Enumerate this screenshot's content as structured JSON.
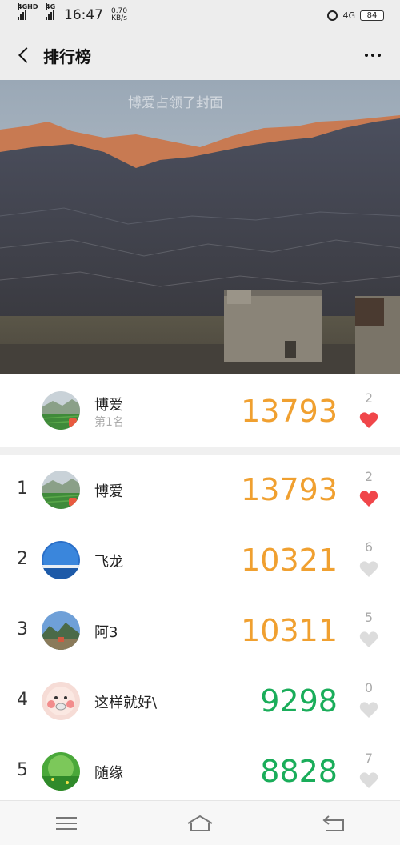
{
  "status_bar": {
    "signal1": "4GHD",
    "signal2": "4G",
    "time": "16:47",
    "speed_value": "0.70",
    "speed_unit": "KB/s",
    "net_right": "4G",
    "battery": "84"
  },
  "nav": {
    "title": "排行榜"
  },
  "cover": {
    "watermark": "博爱占领了封面"
  },
  "my_entry": {
    "name": "博爱",
    "rank_label": "第1名",
    "steps": "13793",
    "likes": "2",
    "liked": true
  },
  "ranking": [
    {
      "rank": "1",
      "name": "博爱",
      "steps": "13793",
      "likes": "2",
      "liked": true,
      "color": "#f0a030"
    },
    {
      "rank": "2",
      "name": "飞龙",
      "steps": "10321",
      "likes": "6",
      "liked": false,
      "color": "#f0a030"
    },
    {
      "rank": "3",
      "name": "阿3",
      "steps": "10311",
      "likes": "5",
      "liked": false,
      "color": "#f0a030"
    },
    {
      "rank": "4",
      "name": "这样就好\\",
      "steps": "9298",
      "likes": "0",
      "liked": false,
      "color": "#1aad5a"
    },
    {
      "rank": "5",
      "name": "随缘",
      "steps": "8828",
      "likes": "7",
      "liked": false,
      "color": "#1aad5a"
    }
  ],
  "colors": {
    "orange": "#f0a030",
    "green": "#1aad5a",
    "heart_red": "#f0464a",
    "heart_gray": "#dcdcdc"
  },
  "icons": {
    "back": "chevron-left-icon",
    "more": "more-dots-icon",
    "heart": "heart-icon",
    "menu": "menu-icon",
    "home": "home-icon",
    "return": "back-arrow-icon"
  }
}
